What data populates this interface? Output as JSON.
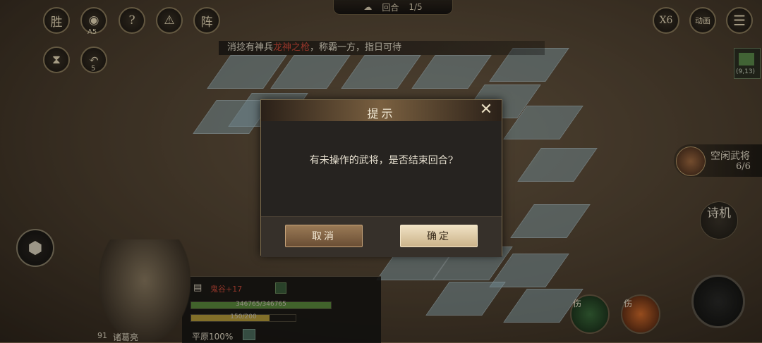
{
  "top_left_buttons": [
    {
      "label": "胜",
      "sub": ""
    },
    {
      "label": "◉",
      "sub": "A5"
    },
    {
      "label": "?",
      "sub": ""
    },
    {
      "label": "⚠",
      "sub": ""
    },
    {
      "label": "阵",
      "sub": ""
    }
  ],
  "row2_buttons": [
    {
      "label": "⧗",
      "sub": ""
    },
    {
      "label": "↶",
      "sub": "5"
    }
  ],
  "round_bar": {
    "label": "回合",
    "value": "1/5"
  },
  "top_right": {
    "speed": "X6",
    "anim": "动画"
  },
  "ticker": {
    "prefix": "消捻有神兵",
    "highlight": "龙神之枪",
    "suffix": "，称霸一方，指日可待"
  },
  "coord": "(9,13)",
  "idle_generals": {
    "label": "空闲武将",
    "value": "6/6"
  },
  "poem_machine": "诗机",
  "dialog": {
    "title": "提示",
    "message": "有未操作的武将，是否结束回合?",
    "cancel_label": "取消",
    "confirm_label": "确定"
  },
  "hero": {
    "level": "91",
    "name": "诸葛亮",
    "buff": "鬼谷+17",
    "hp_text": "346765/346765",
    "mp_text": "150/200",
    "terrain": "平原100%",
    "hp_fraction": 1.0,
    "mp_fraction": 0.75
  },
  "skills": [
    {
      "tag": "伤"
    },
    {
      "tag": "伤"
    }
  ],
  "colors": {
    "hp": "#5a8a3c",
    "mp": "#b59a3a",
    "accent": "#d04a3a"
  }
}
